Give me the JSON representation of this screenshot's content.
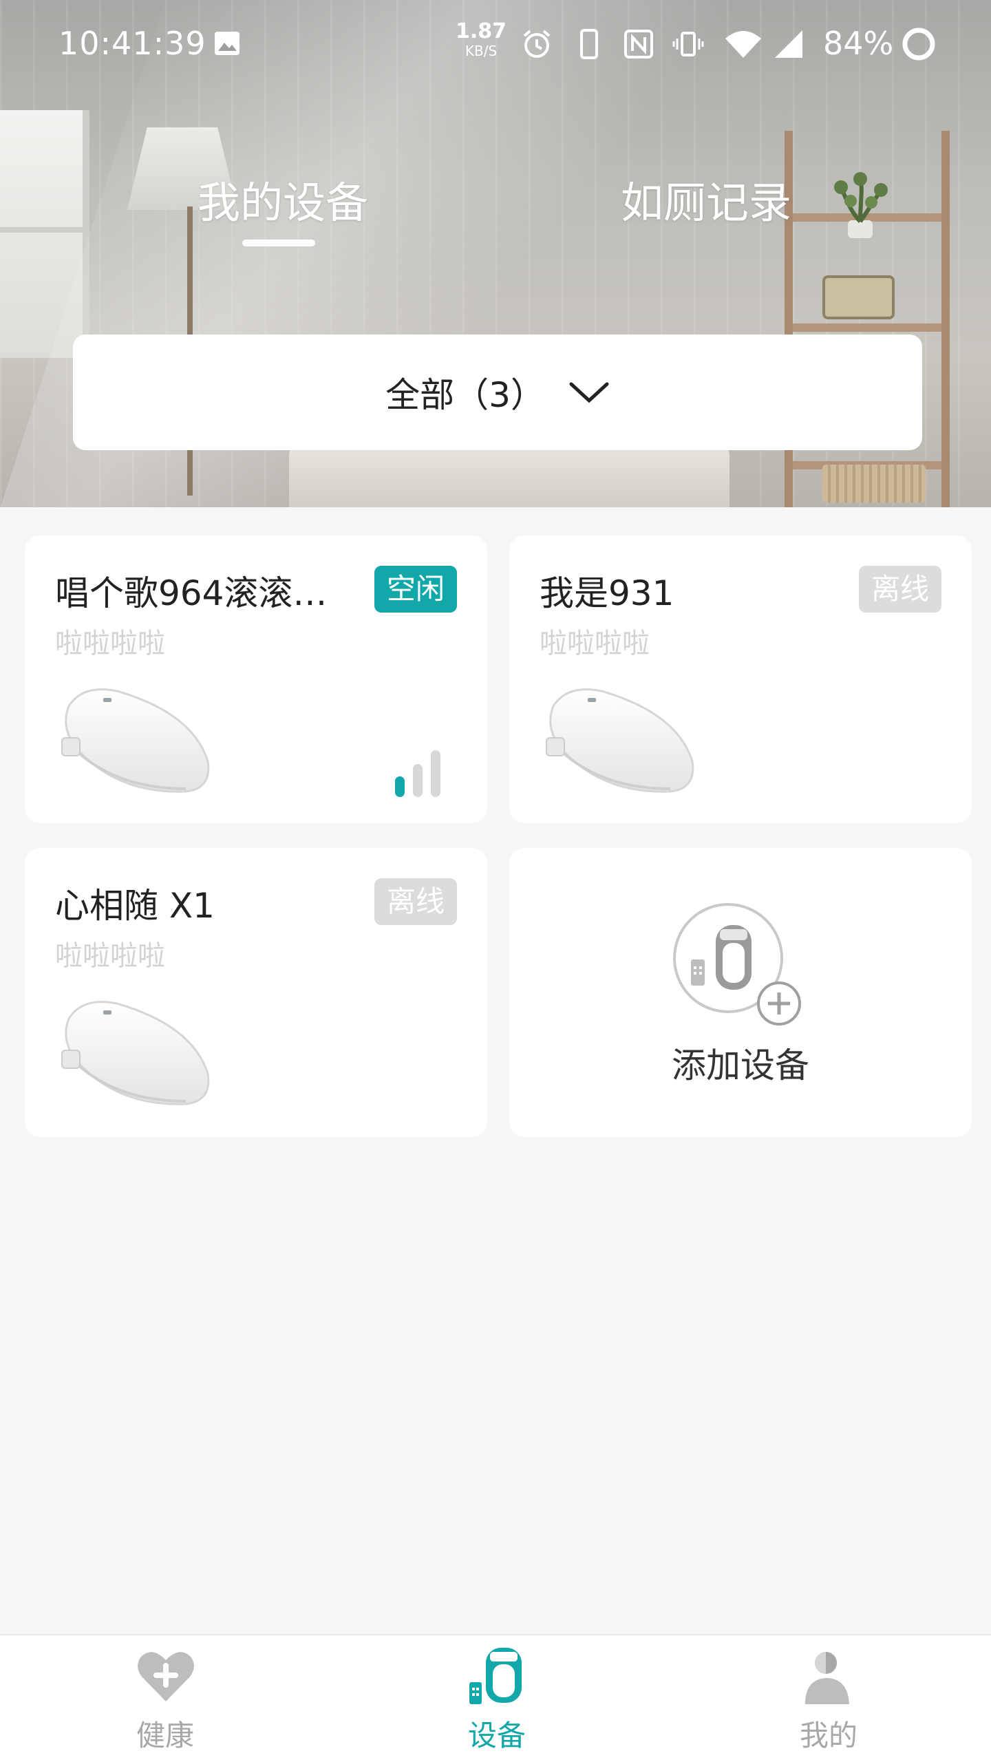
{
  "status_bar": {
    "time": "10:41:39",
    "net_speed_value": "1.87",
    "net_speed_unit": "KB/S",
    "battery": "84%",
    "icons": [
      "gallery-icon",
      "alarm-icon",
      "phone-icon",
      "nfc-icon",
      "vibrate-icon",
      "wifi-icon",
      "cell-signal-icon",
      "battery-ring-icon"
    ]
  },
  "header": {
    "tabs": [
      {
        "label": "我的设备",
        "active": true
      },
      {
        "label": "如厕记录",
        "active": false
      }
    ]
  },
  "filter": {
    "label": "全部（3）",
    "icon": "chevron-down-icon"
  },
  "devices": [
    {
      "name": "唱个歌964滚滚…",
      "subtitle": "啦啦啦啦",
      "status": "空闲",
      "status_kind": "idle",
      "signal": "signal-bars-icon"
    },
    {
      "name": "我是931",
      "subtitle": "啦啦啦啦",
      "status": "离线",
      "status_kind": "offline"
    },
    {
      "name": "心相随 X1",
      "subtitle": "啦啦啦啦",
      "status": "离线",
      "status_kind": "offline"
    }
  ],
  "add_device": {
    "label": "添加设备",
    "icon": "add-device-icon"
  },
  "bottom_nav": [
    {
      "label": "健康",
      "icon": "health-heart-icon",
      "active": false
    },
    {
      "label": "设备",
      "icon": "toilet-device-icon",
      "active": true
    },
    {
      "label": "我的",
      "icon": "profile-icon",
      "active": false
    }
  ],
  "colors": {
    "accent": "#12a7a8",
    "offline_badge": "#dcdcdc",
    "background": "#f6f6f6",
    "inactive_nav": "#a8a8a8"
  }
}
